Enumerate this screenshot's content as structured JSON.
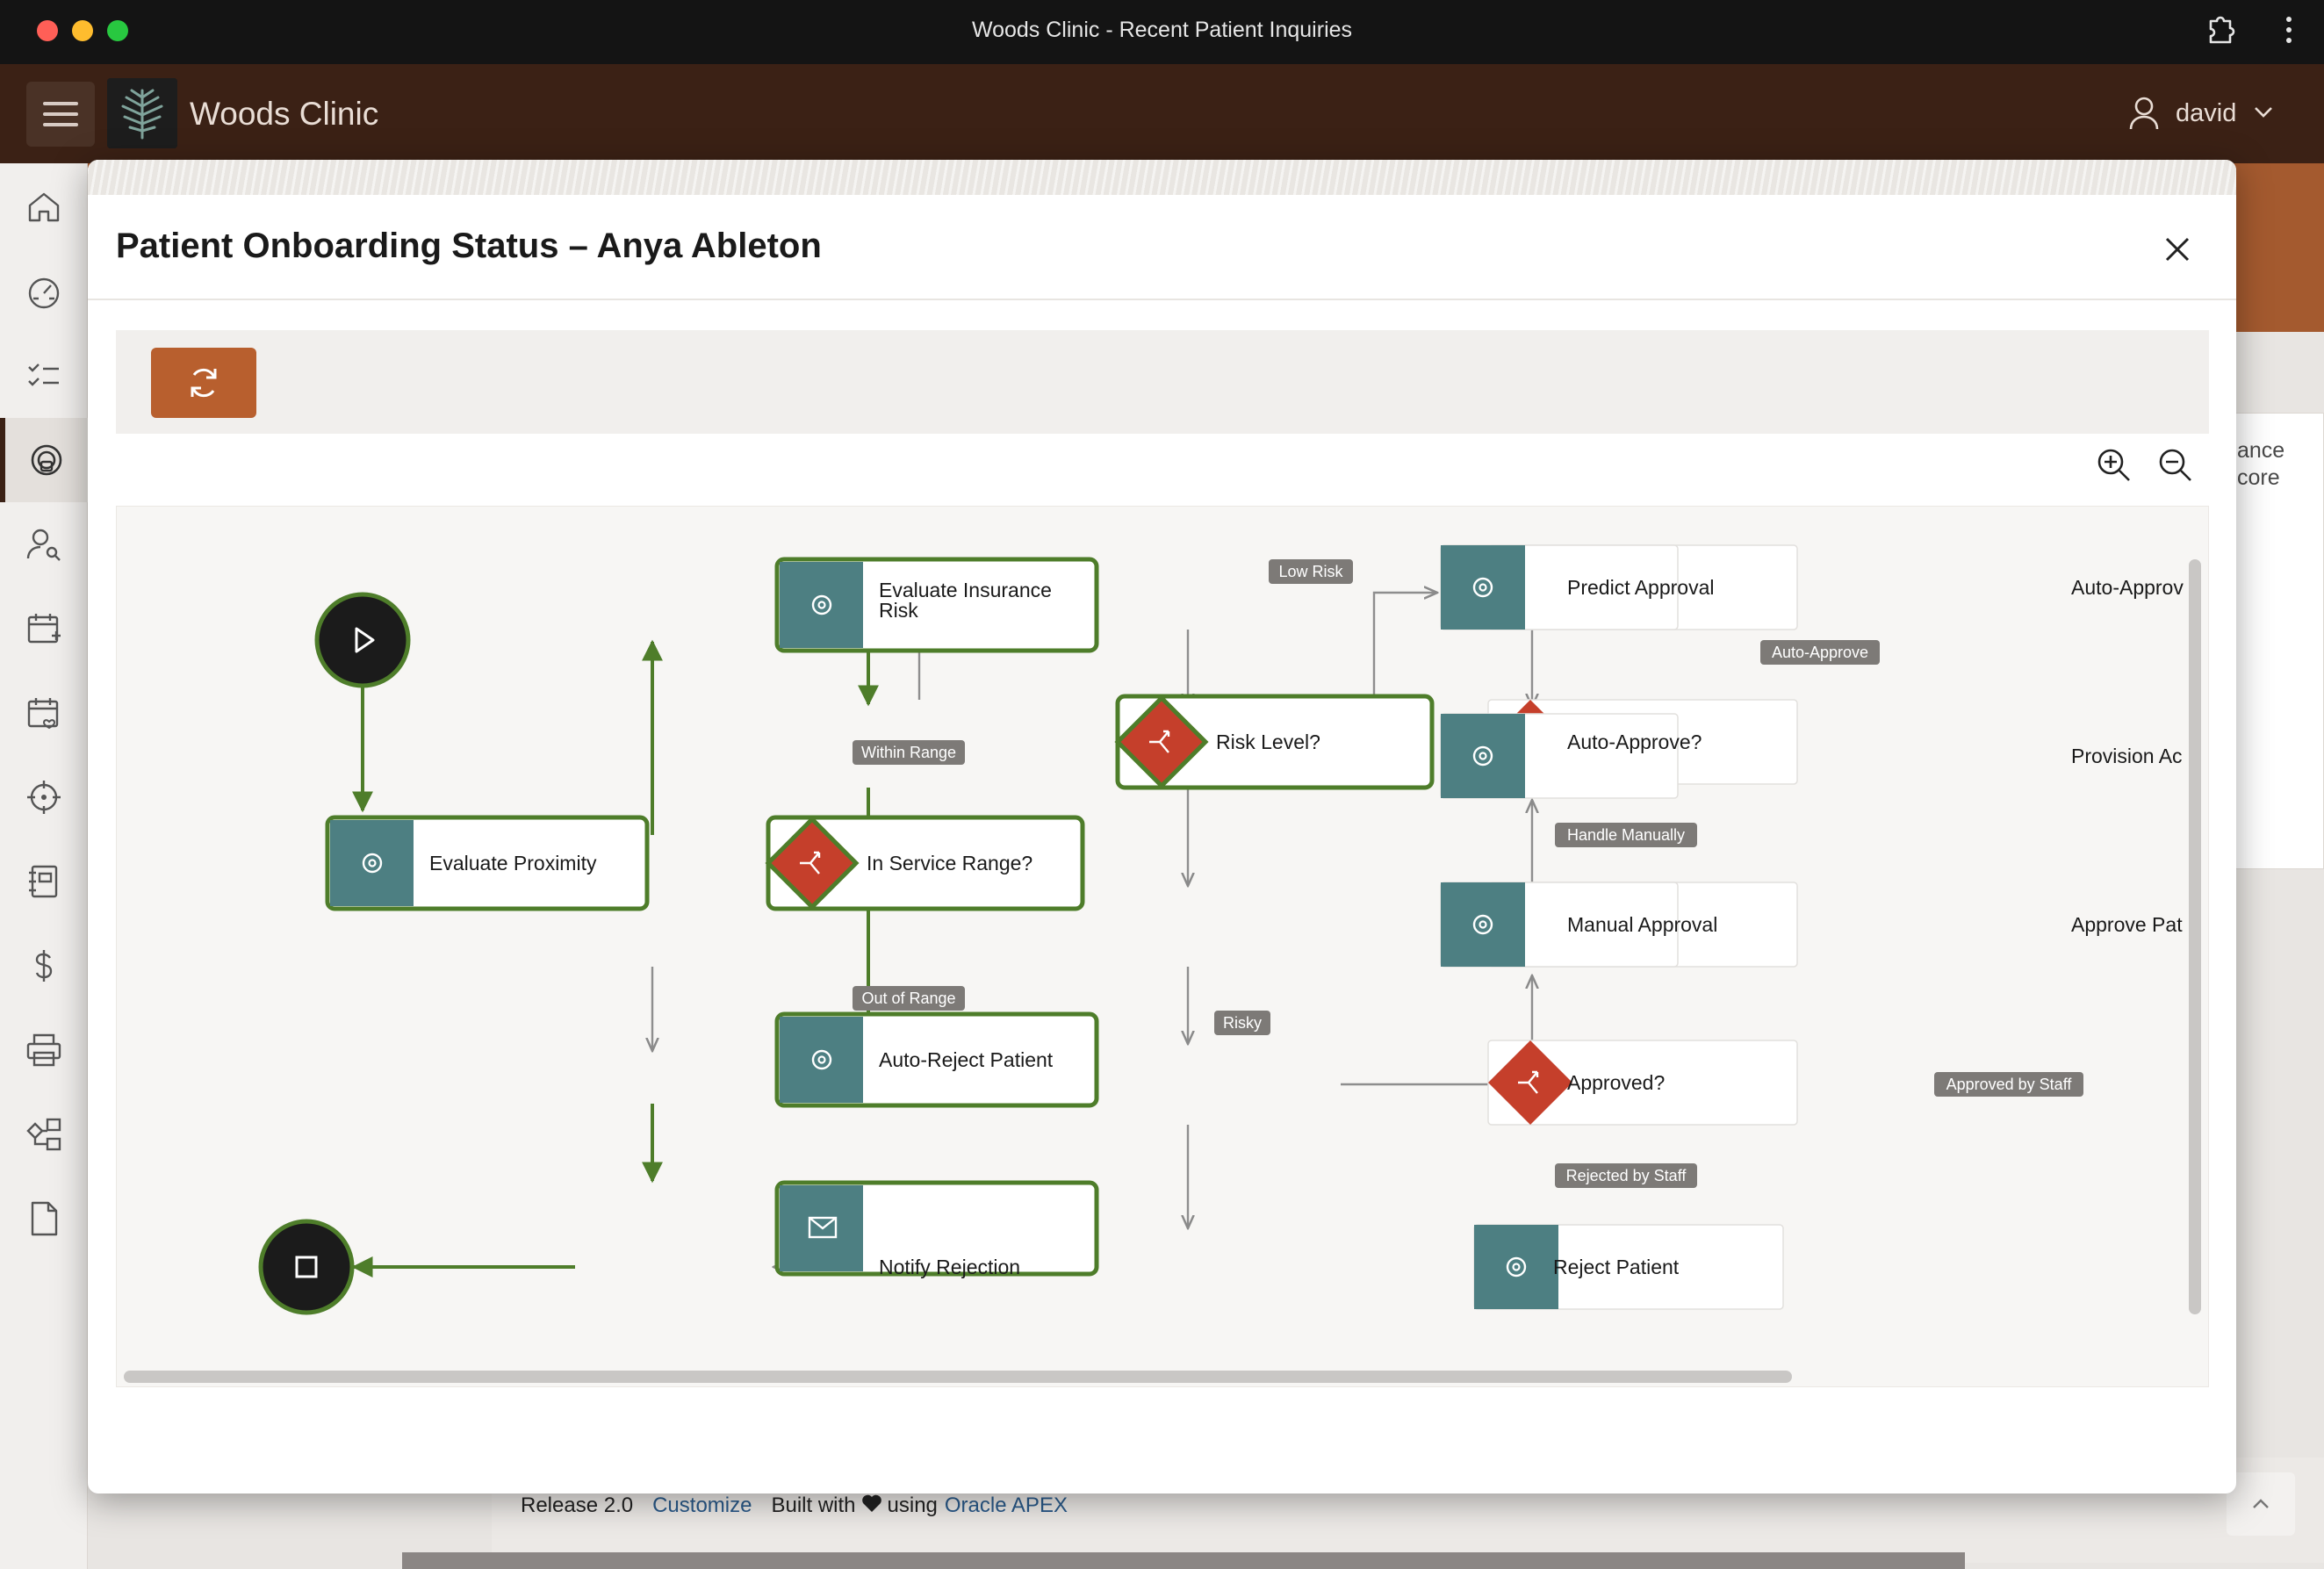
{
  "window": {
    "title": "Woods Clinic - Recent Patient Inquiries"
  },
  "app": {
    "name": "Woods Clinic",
    "user": "david"
  },
  "sidebar": {
    "items": [
      {
        "name": "home-icon"
      },
      {
        "name": "dashboard-icon"
      },
      {
        "name": "checklist-icon"
      },
      {
        "name": "inquiries-icon",
        "active": true
      },
      {
        "name": "patient-search-icon"
      },
      {
        "name": "calendar-add-icon"
      },
      {
        "name": "calendar-check-icon"
      },
      {
        "name": "target-icon"
      },
      {
        "name": "notebook-icon"
      },
      {
        "name": "dollar-icon"
      },
      {
        "name": "printer-icon"
      },
      {
        "name": "workflow-icon"
      },
      {
        "name": "document-icon"
      }
    ]
  },
  "background": {
    "card_text_1": "ance",
    "card_text_2": "core",
    "footer": {
      "release": "Release 2.0",
      "customize": "Customize",
      "built_with": "Built with",
      "using": "using",
      "apex": "Oracle APEX"
    }
  },
  "modal": {
    "title": "Patient Onboarding Status – Anya Ableton",
    "colors": {
      "accent": "#b85f2e",
      "task": "#4d7f82",
      "gateway": "#c53f2b",
      "active_path": "#4e7d2a"
    }
  },
  "diagram": {
    "nodes": {
      "evaluate_insurance_risk": "Evaluate Insurance Risk",
      "evaluate_proximity": "Evaluate Proximity",
      "in_service_range": "In Service Range?",
      "risk_level": "Risk Level?",
      "auto_reject_patient": "Auto-Reject Patient",
      "notify_rejection": "Notify Rejection",
      "predict_approval": "Predict Approval",
      "auto_approve_gw": "Auto-Approve?",
      "manual_approval": "Manual Approval",
      "approved_gw": "Approved?",
      "reject_patient": "Reject Patient",
      "auto_approve_task": "Auto-Approv",
      "provision": "Provision Ac",
      "approve_patient": "Approve Pat"
    },
    "edge_labels": {
      "within_range": "Within Range",
      "out_of_range": "Out of Range",
      "low_risk": "Low Risk",
      "risky": "Risky",
      "auto_approve": "Auto-Approve",
      "handle_manually": "Handle Manually",
      "approved_by_staff": "Approved by Staff",
      "rejected_by_staff": "Rejected by Staff"
    }
  }
}
